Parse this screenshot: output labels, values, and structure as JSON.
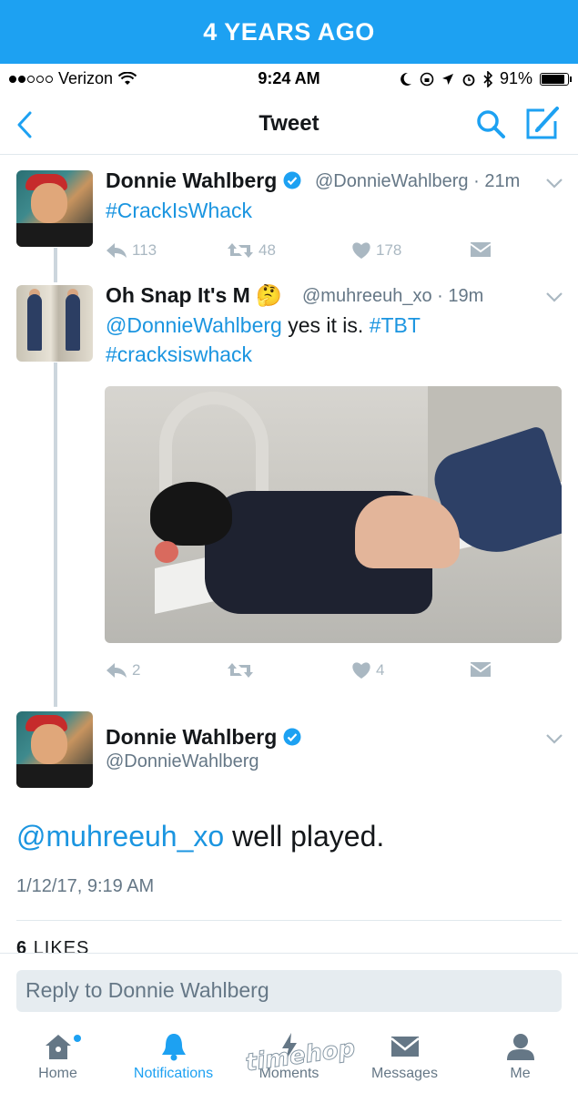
{
  "banner": {
    "text": "4 YEARS AGO"
  },
  "status_bar": {
    "carrier": "Verizon",
    "time": "9:24 AM",
    "battery": "91%",
    "battery_level": 0.91
  },
  "nav": {
    "title": "Tweet"
  },
  "tweet1": {
    "name": "Donnie Wahlberg",
    "handle": "@DonnieWahlberg",
    "time": "· 21m",
    "text": "#CrackIsWhack",
    "replies": "113",
    "retweets": "48",
    "likes": "178"
  },
  "tweet2": {
    "name": "Oh Snap It's M",
    "emoji": "🤔",
    "handle": "@muhreeuh_xo",
    "time": "· 19m",
    "mention": "@DonnieWahlberg",
    "text_mid": " yes it is. ",
    "hashtag1": "#TBT",
    "hashtag2": "#cracksiswhack",
    "replies": "2",
    "likes": "4"
  },
  "main_tweet": {
    "name": "Donnie Wahlberg",
    "handle": "@DonnieWahlberg",
    "mention": "@muhreeuh_xo",
    "text": " well played.",
    "date": "1/12/17, 9:19 AM",
    "likes_count": "6",
    "likes_label": "LIKES"
  },
  "reply": {
    "placeholder": "Reply to Donnie Wahlberg"
  },
  "tabs": {
    "home": "Home",
    "notifications": "Notifications",
    "moments": "Moments",
    "messages": "Messages",
    "me": "Me"
  },
  "watermark": "timehop",
  "colors": {
    "accent": "#1da1f2",
    "link": "#1b95e0",
    "muted": "#657786",
    "action": "#aab8c2"
  }
}
